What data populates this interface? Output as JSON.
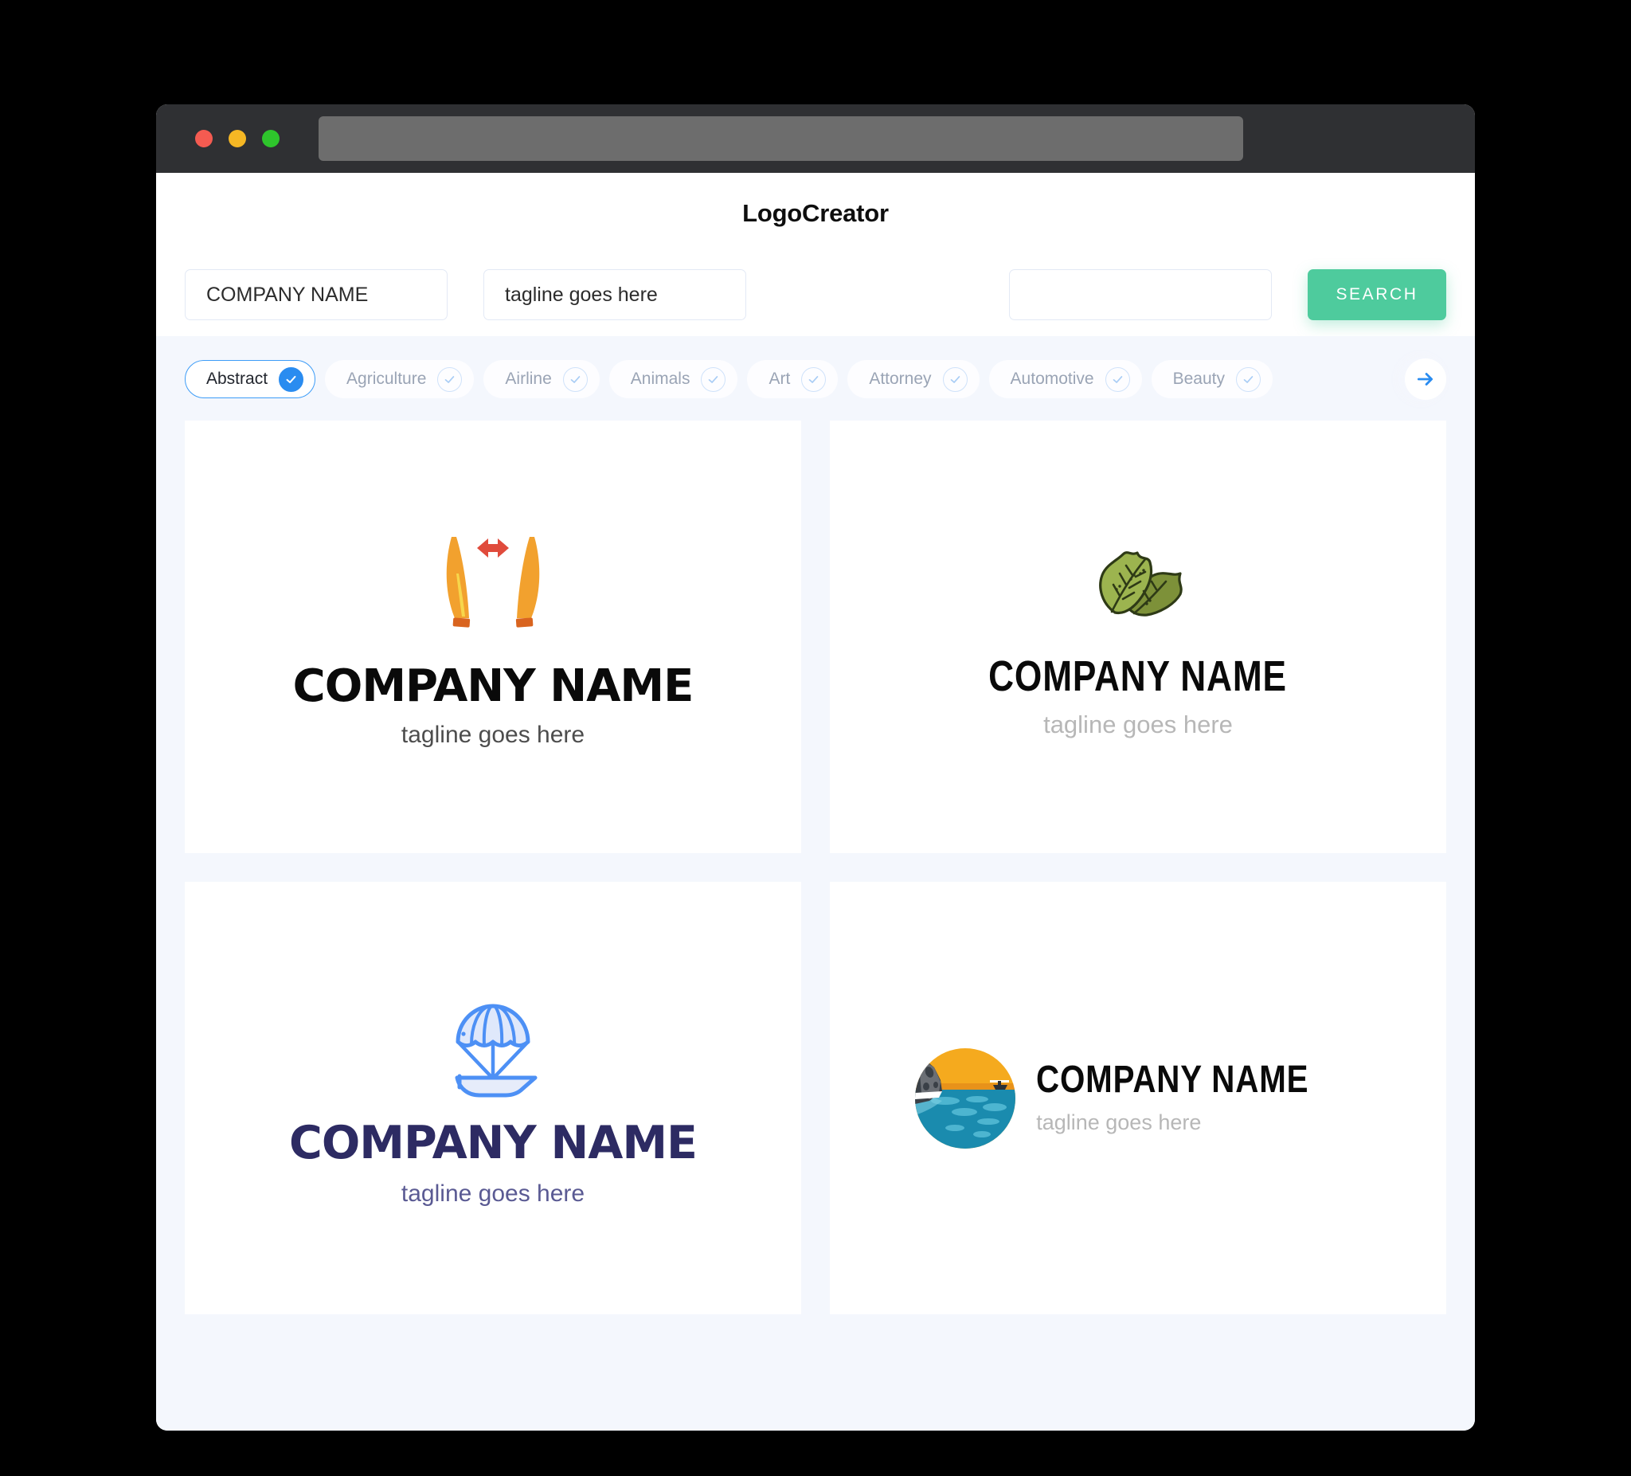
{
  "window": {
    "traffic_lights": [
      "close",
      "minimize",
      "maximize"
    ],
    "url_value": ""
  },
  "header": {
    "title": "LogoCreator"
  },
  "search": {
    "company_value": "COMPANY NAME",
    "company_placeholder": "COMPANY NAME",
    "tagline_value": "tagline goes here",
    "tagline_placeholder": "tagline goes here",
    "extra_value": "",
    "extra_placeholder": "",
    "button_label": "SEARCH",
    "button_color": "#4ecb9d"
  },
  "categories": {
    "next_icon": "arrow-right-icon",
    "items": [
      {
        "label": "Abstract",
        "selected": true,
        "icon": "check-icon"
      },
      {
        "label": "Agriculture",
        "selected": false,
        "icon": "check-icon"
      },
      {
        "label": "Airline",
        "selected": false,
        "icon": "check-icon"
      },
      {
        "label": "Animals",
        "selected": false,
        "icon": "check-icon"
      },
      {
        "label": "Art",
        "selected": false,
        "icon": "check-icon"
      },
      {
        "label": "Attorney",
        "selected": false,
        "icon": "check-icon"
      },
      {
        "label": "Automotive",
        "selected": false,
        "icon": "check-icon"
      },
      {
        "label": "Beauty",
        "selected": false,
        "icon": "check-icon"
      }
    ],
    "selected_color": "#2a8cf0"
  },
  "results": [
    {
      "icon": "twin-blades-arrow-icon",
      "name": "COMPANY NAME",
      "tagline": "tagline goes here",
      "name_color": "#0a0a0a",
      "tagline_color": "#4d4d4d",
      "layout": "stacked"
    },
    {
      "icon": "leaf-icon",
      "name": "COMPANY NAME",
      "tagline": "tagline goes here",
      "name_color": "#0a0a0a",
      "tagline_color": "#b7b7b7",
      "layout": "stacked"
    },
    {
      "icon": "parachute-boat-icon",
      "name": "COMPANY NAME",
      "tagline": "tagline goes here",
      "name_color": "#2d2b63",
      "tagline_color": "#5a5a93",
      "layout": "stacked"
    },
    {
      "icon": "sunset-sea-circle-icon",
      "name": "COMPANY NAME",
      "tagline": "tagline goes here",
      "name_color": "#0a0a0a",
      "tagline_color": "#b7b7b7",
      "layout": "horizontal"
    }
  ]
}
